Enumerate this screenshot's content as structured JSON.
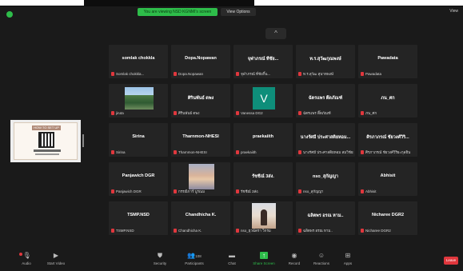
{
  "topbar": {
    "share_banner": "You are viewing NSD KGNMI's screen",
    "view_options": "View Options",
    "view_button": "View"
  },
  "share": {
    "label": "HOW TO SET UP"
  },
  "participants": [
    {
      "name": "somlak chokkla",
      "footer": "Somlak chokkla..."
    },
    {
      "name": "Dopa.Nopawan",
      "footer": "Dopa.Nopawan"
    },
    {
      "name": "จุฬาภรณ์ ที่ชัย...",
      "footer": "จุฬาภรณ์ ที่ชัยกิ้น..."
    },
    {
      "name": "ท.ร.สุวัฒกุณพงษ์",
      "footer": "ท.ร.สุวัฒ สุนาทพงษ์"
    },
    {
      "name": "Pawadata",
      "footer": "Pawadata"
    },
    {
      "name": "",
      "footer": "jiruta"
    },
    {
      "name": "ศิรินพันธ์ ดพง",
      "footer": "ศิรินพันธ์ ดพง"
    },
    {
      "name": "",
      "footer": "Vanessa DG2"
    },
    {
      "name": "ฉัตรแพร ติ๊ดภัณฑ์",
      "footer": "ฉัตรแพร ติ๊ดภัณฑ์"
    },
    {
      "name": "ภน_ศก",
      "footer": "ภน_ศก"
    },
    {
      "name": "Sirina",
      "footer": "Sirina"
    },
    {
      "name": "Tharnmon-NHESI",
      "footer": "Tharnmon-NHESI"
    },
    {
      "name": "praekaiith",
      "footer": "praekaiith"
    },
    {
      "name": "นางรัศมี ประศาสติยหอม...",
      "footer": "นางรัศมี ประศาสติยหอม สมวิชัยกุล"
    },
    {
      "name": "ศิรภาภรณ์ ชัยวงศ์วิริ...",
      "footer": "ศิรภาภรณ์ ชัยวงศ์วิริยะกุลฮิน"
    },
    {
      "name": "Panjawich DGR",
      "footer": "Panjawich DGR"
    },
    {
      "name": "",
      "footer": "กรรณิการ์ บูรณม"
    },
    {
      "name": "รัชชีณ์ 3ส่ง.",
      "footer": "รัชชีณ์ 3ส่ง."
    },
    {
      "name": "nso_สุกัญญา",
      "footer": "nso_สุกัญญา"
    },
    {
      "name": "Abhisit",
      "footer": "Abhisit"
    },
    {
      "name": "TSMP.NSD",
      "footer": "TSMP.NSD"
    },
    {
      "name": "Chandhicha K.",
      "footer": "Chandhicha K."
    },
    {
      "name": "",
      "footer": "nso_ยุวฉัตรา วิกรม"
    },
    {
      "name": "ฉลิตพร อรณ หาม..",
      "footer": "ฉลิตพร อรณ หาม.."
    },
    {
      "name": "Nicharee DGR2",
      "footer": "Nicharee DGR2"
    }
  ],
  "toolbar": {
    "audio": "Audio",
    "video": "Start Video",
    "security": "Security",
    "participants": "Participants",
    "participants_count": "108",
    "chat": "Chat",
    "share": "Share Screen",
    "record": "Record",
    "reactions": "Reactions",
    "apps": "Apps",
    "end": "Leave"
  }
}
